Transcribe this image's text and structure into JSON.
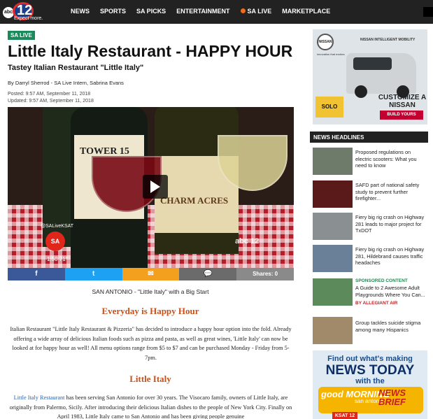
{
  "header": {
    "logo_number": "12",
    "logo_station": "KSAT",
    "logo_network": "abc",
    "logo_tagline": "Expect more.",
    "nav": [
      "NEWS",
      "SPORTS",
      "SA PICKS",
      "ENTERTAINMENT",
      "SA LIVE",
      "MARKETPLACE"
    ]
  },
  "article": {
    "section_badge": "SA LIVE",
    "title": "Little Italy Restaurant - HAPPY HOUR",
    "subtitle": "Tastey Italian Restaurant \"Little Italy\"",
    "byline": "By Darryl Sherrod - SA Live Intern, Sabrina Evans",
    "posted": "Posted: 9:57 AM, September 11, 2018",
    "updated": "Updated: 9:57 AM, September 11, 2018",
    "video": {
      "watermark_handle": "@SALiveKSAT",
      "watermark_logo": "SA",
      "time": "1:50  71°",
      "bottle_label_1": "TOWER 15",
      "bottle_label_2": "CHARM ACRES",
      "network_bug": "abc 12"
    },
    "share": {
      "facebook": "f",
      "twitter": "t",
      "email": "✉",
      "comments": "💬",
      "shares_label": "Shares: 0"
    },
    "lead": "SAN ANTONIO - \"Little Italy\" with a Big Start",
    "heading_1": "Everyday is Happy Hour",
    "para_1": "Italian Restaurant \"Little Italy Restaurant & Pizzeria\" has decided to introduce a happy hour option into the fold. Already offering a wide array of delicious Italian foods such as pizza and pasta, as well as great wines, 'Little Italy' can now be looked at for happy hour as well! All menu options range from $5 to $7 and can be purchased Monday - Friday from 5-7pm.",
    "heading_2": "Little Italy",
    "para_2_link": "Little Italy Restaurant",
    "para_2": " has been serving San Antonio for over 30 years. The Visocaro family, owners of Little Italy, are originally from Palermo, Sicily. After introducing their delicious Italian dishes to the people of New York City. Finally on April 1983, Little Italy came to San Antonio and has been giving people genuine"
  },
  "sidebar": {
    "ad_top": {
      "brand": "NISSAN",
      "tagline": "innovation that excites",
      "headline": "NISSAN INTELLIGENT MOBILITY",
      "promo": "SOLO",
      "cta_text": "CUSTOMIZE A NISSAN",
      "cta_button": "BUILD YOURS"
    },
    "news_headlines_title": "NEWS HEADLINES",
    "headlines": [
      {
        "text": "Proposed regulations on electric scooters: What you need to know"
      },
      {
        "text": "SAFD part of national safety study to prevent further firefighter..."
      },
      {
        "text": "Fiery big rig crash on Highway 281 leads to major project for TxDOT"
      },
      {
        "text": "Fiery big rig crash on Highway 281, Hildebrand causes traffic headaches"
      },
      {
        "sponsored": "SPONSORED CONTENT",
        "text": "A Guide to 2 Awesome Adult Playgrounds Where You Can...",
        "by": "BY ALLEGIANT AIR"
      },
      {
        "text": "Group tackles suicide stigma among many Hispanics"
      }
    ],
    "ad_bottom": {
      "line1": "Find out what's making",
      "line2": "NEWS TODAY",
      "line3": "with the",
      "show1": "good MORNING",
      "show2": "san antonio",
      "show3": "NEWS BRIEF",
      "station": "KSAT 12"
    }
  },
  "colors": {
    "nav_bg": "#222222",
    "badge_green": "#1b8a5a",
    "heading_orange": "#c8511a",
    "link_blue": "#2a62b0",
    "sa_live_dot": "#ef6c1a"
  }
}
